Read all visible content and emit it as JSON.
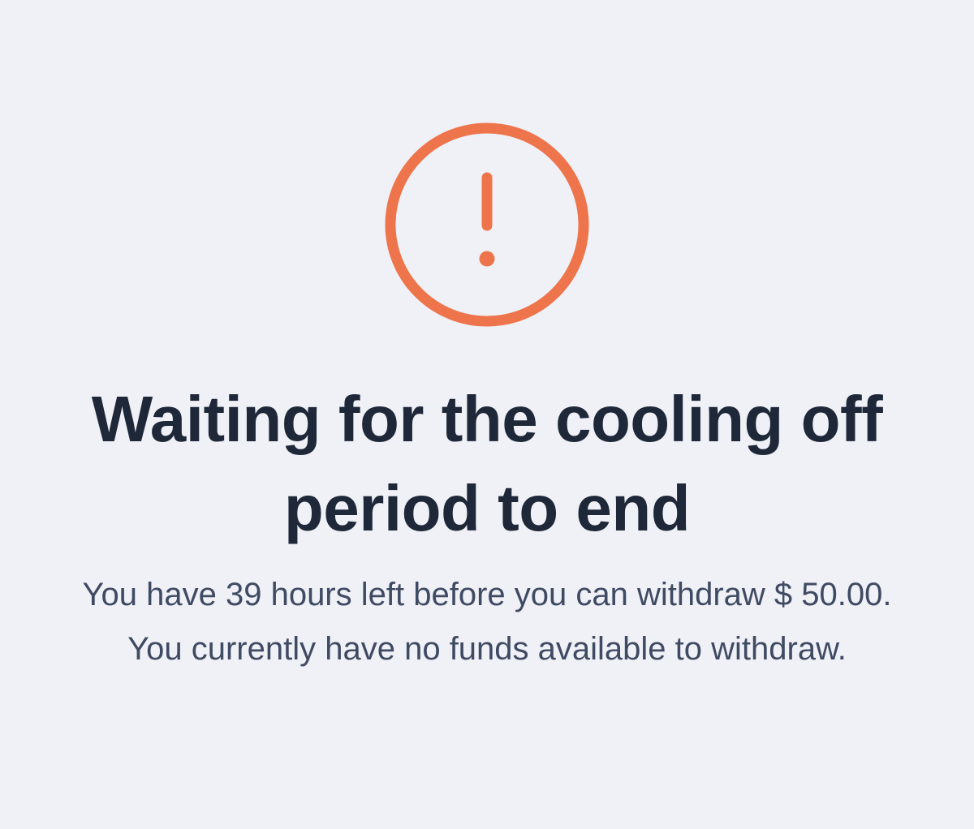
{
  "colors": {
    "background": "#f0f1f7",
    "alert_accent": "#ee744c",
    "title_text": "#1e2839",
    "body_text": "#3f4a63"
  },
  "status": {
    "icon": "exclamation-circle-icon",
    "title": "Waiting for the cooling off period to end",
    "message": "You have 39 hours left before you can withdraw $ 50.00. You currently have no funds available to withdraw."
  }
}
